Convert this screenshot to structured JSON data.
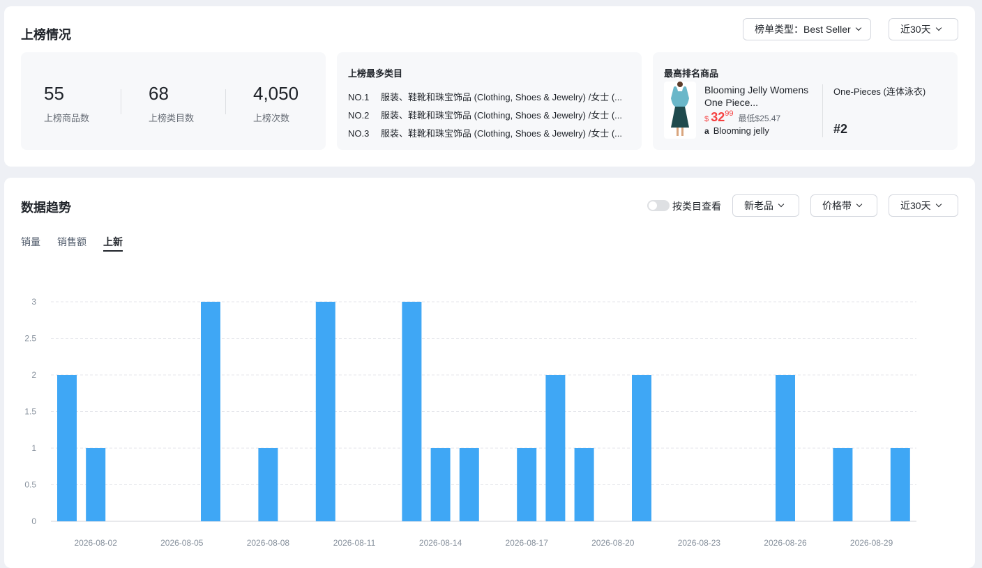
{
  "ranking": {
    "title": "上榜情况",
    "list_type_dropdown": "榜单类型：Best Seller",
    "period_dropdown": "近30天",
    "stats": [
      {
        "value": "55",
        "label": "上榜商品数"
      },
      {
        "value": "68",
        "label": "上榜类目数"
      },
      {
        "value": "4,050",
        "label": "上榜次数"
      }
    ],
    "top_categories": {
      "title": "上榜最多类目",
      "rows": [
        {
          "no": "NO.1",
          "text": "服装、鞋靴和珠宝饰品 (Clothing, Shoes & Jewelry) /女士 (..."
        },
        {
          "no": "NO.2",
          "text": "服装、鞋靴和珠宝饰品 (Clothing, Shoes & Jewelry) /女士 (..."
        },
        {
          "no": "NO.3",
          "text": "服装、鞋靴和珠宝饰品 (Clothing, Shoes & Jewelry) /女士 (..."
        }
      ]
    },
    "top_product": {
      "title": "最高排名商品",
      "name": "Blooming Jelly Womens One Piece...",
      "currency": "$",
      "price_int": "32",
      "price_dec": "99",
      "lowest": "最低$25.47",
      "brand_icon": "amazon-icon",
      "brand_logo": "a",
      "brand": "Blooming jelly",
      "category": "One-Pieces (连体泳衣)",
      "rank": "#2"
    }
  },
  "trend": {
    "title": "数据趋势",
    "toggle_label": "按类目查看",
    "toggle_on": false,
    "filters": [
      "新老品",
      "价格带",
      "近30天"
    ],
    "tabs": [
      "销量",
      "销售额",
      "上新"
    ],
    "active_tab": 2
  },
  "colors": {
    "bar": "#3fa7f5",
    "grid": "#e5e6eb",
    "axis_text": "#86909c"
  },
  "chart_data": {
    "type": "bar",
    "title": "",
    "xlabel": "",
    "ylabel": "",
    "ylim": [
      0,
      3
    ],
    "yticks": [
      "0",
      "0.5",
      "1",
      "1.5",
      "2",
      "2.5",
      "3"
    ],
    "grid": true,
    "categories": [
      "2026-08-01",
      "2026-08-02",
      "2026-08-03",
      "2026-08-04",
      "2026-08-05",
      "2026-08-06",
      "2026-08-07",
      "2026-08-08",
      "2026-08-09",
      "2026-08-10",
      "2026-08-11",
      "2026-08-12",
      "2026-08-13",
      "2026-08-14",
      "2026-08-15",
      "2026-08-16",
      "2026-08-17",
      "2026-08-18",
      "2026-08-19",
      "2026-08-20",
      "2026-08-21",
      "2026-08-22",
      "2026-08-23",
      "2026-08-24",
      "2026-08-25",
      "2026-08-26",
      "2026-08-27",
      "2026-08-28",
      "2026-08-29",
      "2026-08-30"
    ],
    "values": [
      2,
      1,
      0,
      0,
      0,
      3,
      0,
      1,
      0,
      3,
      0,
      0,
      3,
      1,
      1,
      0,
      1,
      2,
      1,
      0,
      2,
      0,
      0,
      0,
      0,
      2,
      0,
      1,
      0,
      1
    ],
    "xtick_labels": [
      "2026-08-02",
      "2026-08-05",
      "2026-08-08",
      "2026-08-11",
      "2026-08-14",
      "2026-08-17",
      "2026-08-20",
      "2026-08-23",
      "2026-08-26",
      "2026-08-29"
    ]
  }
}
